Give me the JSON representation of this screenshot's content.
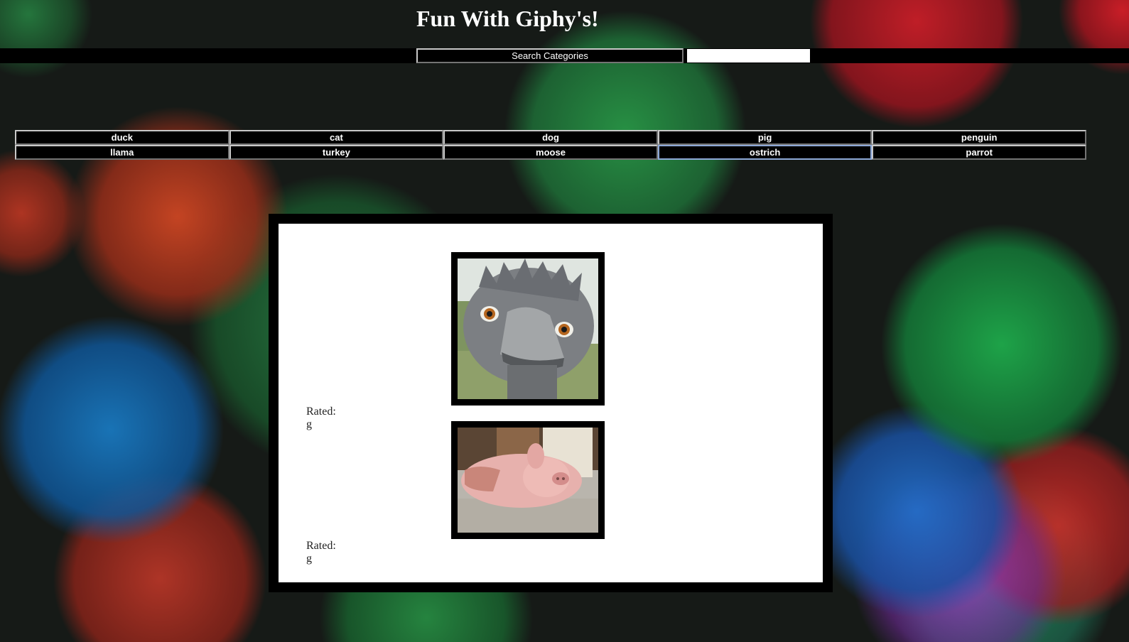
{
  "header": {
    "title": "Fun With Giphy's!"
  },
  "search": {
    "button_label": "Search Categories",
    "input_value": "",
    "placeholder": ""
  },
  "categories": [
    "duck",
    "cat",
    "dog",
    "pig",
    "penguin",
    "llama",
    "turkey",
    "moose",
    "ostrich",
    "parrot"
  ],
  "results": [
    {
      "subject": "ostrich-close-up",
      "rating_label": "Rated: g"
    },
    {
      "subject": "pig-lying-on-floor",
      "rating_label": "Rated: g"
    }
  ],
  "colors": {
    "page_text": "#ffffff",
    "button_bg": "#000000",
    "panel_bg": "#ffffff",
    "focus_ring": "#8da8d8"
  }
}
